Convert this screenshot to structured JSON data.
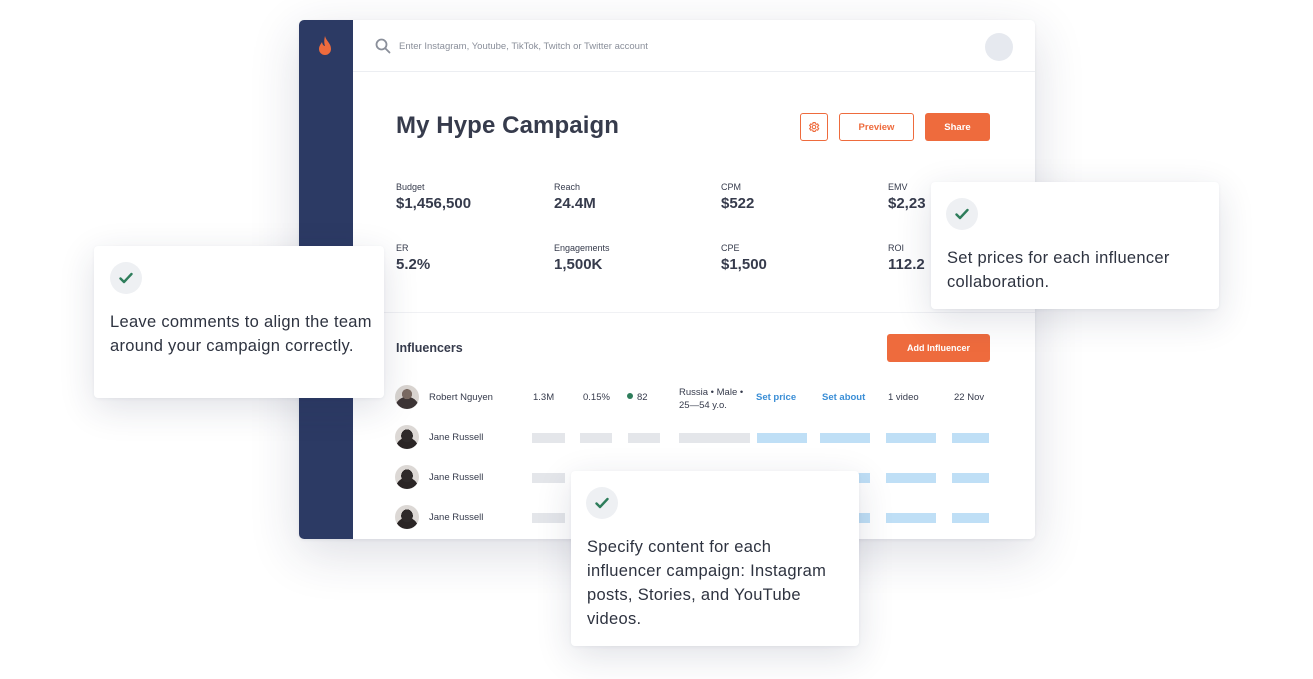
{
  "colors": {
    "accent": "#ee6b3d",
    "sidebar": "#2c3a64",
    "link": "#3a8ed6",
    "check": "#2e7d5b"
  },
  "topbar": {
    "search_placeholder": "Enter Instagram, Youtube, TikTok, Twitch or Twitter account",
    "search_icon": "search-icon"
  },
  "campaign": {
    "title": "My Hype Campaign",
    "settings_icon": "gear-icon",
    "preview_label": "Preview",
    "share_label": "Share"
  },
  "metrics": [
    {
      "label": "Budget",
      "value": "$1,456,500"
    },
    {
      "label": "Reach",
      "value": "24.4M"
    },
    {
      "label": "CPM",
      "value": "$522"
    },
    {
      "label": "EMV",
      "value": "$2,23"
    },
    {
      "label": "ER",
      "value": "5.2%"
    },
    {
      "label": "Engagements",
      "value": "1,500K"
    },
    {
      "label": "CPE",
      "value": "$1,500"
    },
    {
      "label": "ROI",
      "value": "112.2"
    }
  ],
  "influencers": {
    "title": "Influencers",
    "add_label": "Add Influencer",
    "rows": [
      {
        "name": "Robert Nguyen",
        "followers": "1.3M",
        "er": "0.15%",
        "score": "82",
        "audience_line1": "Russia • Male •",
        "audience_line2": "25—54 y.o.",
        "price": "Set price",
        "about": "Set about",
        "content": "1 video",
        "date": "22 Nov"
      },
      {
        "name": "Jane Russell"
      },
      {
        "name": "Jane Russell"
      },
      {
        "name": "Jane Russell"
      }
    ]
  },
  "cards": [
    {
      "text": "Leave comments to align the team around your campaign correctly."
    },
    {
      "text": "Set prices for each influencer collaboration."
    },
    {
      "text": "Specify content for each influencer campaign: Instagram posts, Stories, and YouTube videos."
    }
  ]
}
